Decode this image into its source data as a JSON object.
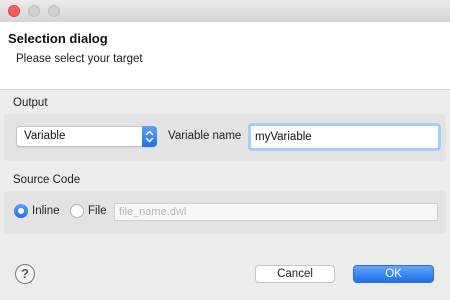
{
  "window": {
    "header": {
      "title": "Selection dialog",
      "message": "Please select your target"
    }
  },
  "output": {
    "group_label": "Output",
    "type_select": {
      "value": "Variable"
    },
    "variable_name_label": "Variable name",
    "variable_name_value": "myVariable"
  },
  "source_code": {
    "group_label": "Source Code",
    "inline_label": "Inline",
    "inline_selected": true,
    "file_label": "File",
    "file_selected": false,
    "file_placeholder": "file_name.dwl"
  },
  "footer": {
    "help_glyph": "?",
    "cancel_label": "Cancel",
    "ok_label": "OK"
  },
  "colors": {
    "accent": "#1f72e8",
    "close_button": "#fc5f57"
  }
}
